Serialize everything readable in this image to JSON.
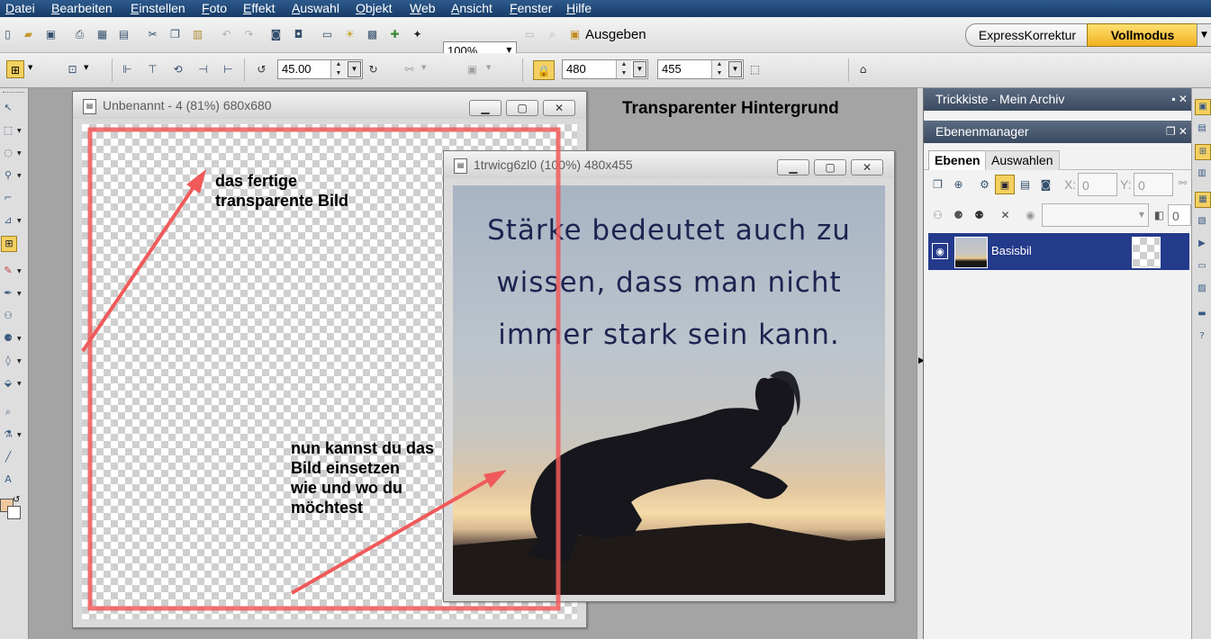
{
  "menu": [
    "Datei",
    "Bearbeiten",
    "Einstellen",
    "Foto",
    "Effekt",
    "Auswahl",
    "Objekt",
    "Web",
    "Ansicht",
    "Fenster",
    "Hilfe"
  ],
  "toolbar1": {
    "zoom": "100%",
    "output_label": "Ausgeben",
    "express_label": "ExpressKorrektur",
    "full_label": "Vollmodus"
  },
  "toolbar2": {
    "angle": "45.00",
    "width": "480",
    "height": "455"
  },
  "canvas_heading": "Transparenter Hintergrund",
  "window1": {
    "title": "Unbenannt - 4 (81%) 680x680"
  },
  "window2": {
    "title": "1trwicg6zl0 (100%) 480x455"
  },
  "photo_quote": [
    "Stärke bedeutet auch zu",
    "wissen, dass man nicht",
    "immer stark sein kann."
  ],
  "notes": {
    "note1": [
      "das fertige",
      "transparente Bild"
    ],
    "note2": [
      "nun kannst du das",
      "Bild einsetzen",
      "wie und wo du",
      "möchtest"
    ]
  },
  "panels": {
    "trickkiste": "Trickkiste - Mein Archiv",
    "ebenenmanager": "Ebenenmanager",
    "tabs": [
      "Ebenen",
      "Auswahlen"
    ],
    "x_label": "X:",
    "x_value": "0",
    "y_label": "Y:",
    "y_value": "0",
    "opacity_value": "0",
    "layer_name": "Basisbil"
  },
  "colors": {
    "menu_bg": "#1f4a7a",
    "accent_yellow": "#f2c230",
    "layer_selected": "#2a3f8a",
    "annotation_red": "#f06060"
  }
}
